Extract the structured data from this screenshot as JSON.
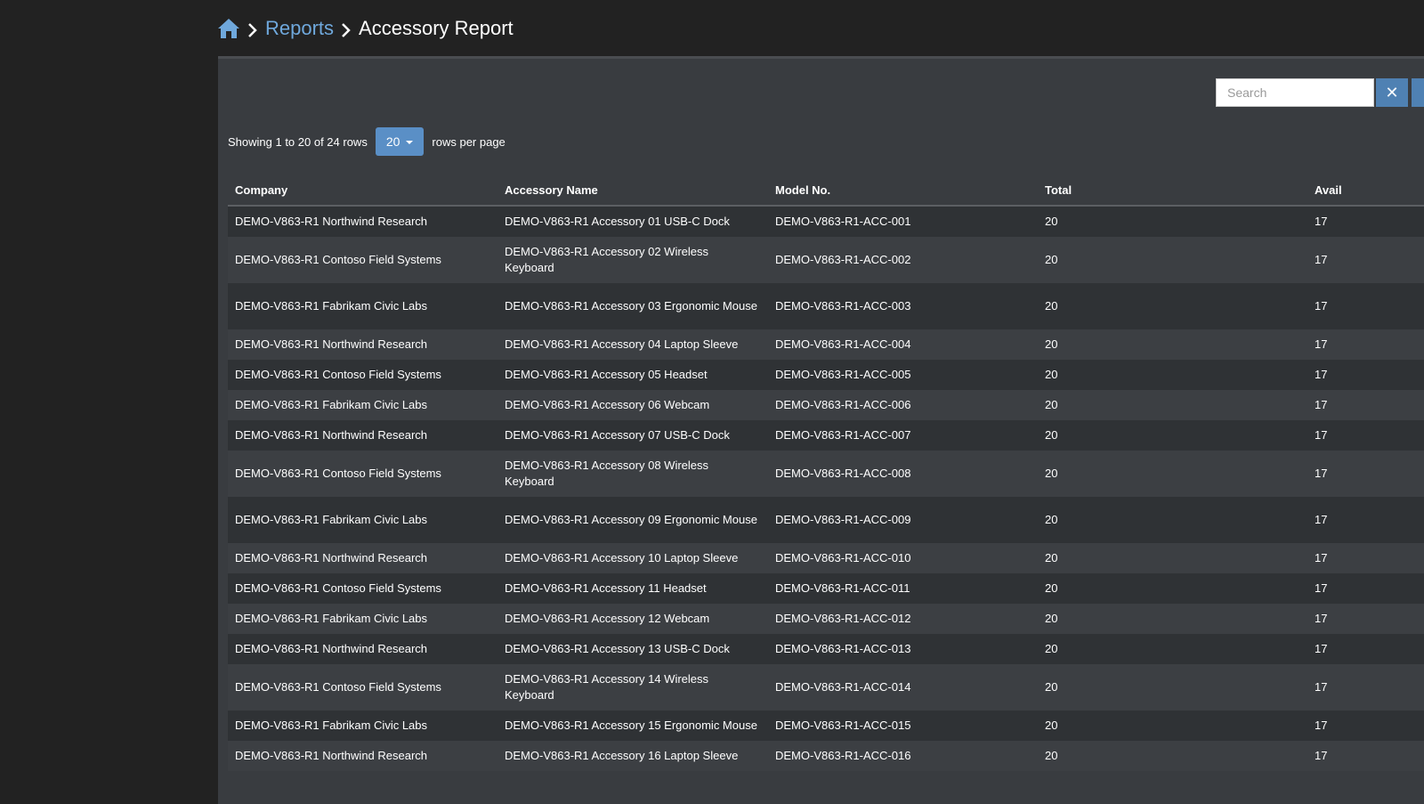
{
  "breadcrumb": {
    "home_icon": "home-icon",
    "parent": "Reports",
    "current": "Accessory Report"
  },
  "toolbar": {
    "search_placeholder": "Search",
    "clear_label": "✕"
  },
  "pagination": {
    "showing_text": "Showing 1 to 20 of 24 rows",
    "page_size": "20",
    "per_page_text": "rows per page"
  },
  "table": {
    "headers": [
      "Company",
      "Accessory Name",
      "Model No.",
      "Total",
      "Avail"
    ],
    "rows": [
      {
        "company": "DEMO-V863-R1 Northwind Research",
        "name": "DEMO-V863-R1 Accessory 01 USB-C Dock",
        "model": "DEMO-V863-R1-ACC-001",
        "total": "20",
        "avail": "17"
      },
      {
        "company": "DEMO-V863-R1 Contoso Field Systems",
        "name": "DEMO-V863-R1 Accessory 02 Wireless Keyboard",
        "model": "DEMO-V863-R1-ACC-002",
        "total": "20",
        "avail": "17"
      },
      {
        "company": "DEMO-V863-R1 Fabrikam Civic Labs",
        "name": "DEMO-V863-R1 Accessory 03 Ergonomic Mouse",
        "model": "DEMO-V863-R1-ACC-003",
        "total": "20",
        "avail": "17"
      },
      {
        "company": "DEMO-V863-R1 Northwind Research",
        "name": "DEMO-V863-R1 Accessory 04 Laptop Sleeve",
        "model": "DEMO-V863-R1-ACC-004",
        "total": "20",
        "avail": "17"
      },
      {
        "company": "DEMO-V863-R1 Contoso Field Systems",
        "name": "DEMO-V863-R1 Accessory 05 Headset",
        "model": "DEMO-V863-R1-ACC-005",
        "total": "20",
        "avail": "17"
      },
      {
        "company": "DEMO-V863-R1 Fabrikam Civic Labs",
        "name": "DEMO-V863-R1 Accessory 06 Webcam",
        "model": "DEMO-V863-R1-ACC-006",
        "total": "20",
        "avail": "17"
      },
      {
        "company": "DEMO-V863-R1 Northwind Research",
        "name": "DEMO-V863-R1 Accessory 07 USB-C Dock",
        "model": "DEMO-V863-R1-ACC-007",
        "total": "20",
        "avail": "17"
      },
      {
        "company": "DEMO-V863-R1 Contoso Field Systems",
        "name": "DEMO-V863-R1 Accessory 08 Wireless Keyboard",
        "model": "DEMO-V863-R1-ACC-008",
        "total": "20",
        "avail": "17"
      },
      {
        "company": "DEMO-V863-R1 Fabrikam Civic Labs",
        "name": "DEMO-V863-R1 Accessory 09 Ergonomic Mouse",
        "model": "DEMO-V863-R1-ACC-009",
        "total": "20",
        "avail": "17"
      },
      {
        "company": "DEMO-V863-R1 Northwind Research",
        "name": "DEMO-V863-R1 Accessory 10 Laptop Sleeve",
        "model": "DEMO-V863-R1-ACC-010",
        "total": "20",
        "avail": "17"
      },
      {
        "company": "DEMO-V863-R1 Contoso Field Systems",
        "name": "DEMO-V863-R1 Accessory 11 Headset",
        "model": "DEMO-V863-R1-ACC-011",
        "total": "20",
        "avail": "17"
      },
      {
        "company": "DEMO-V863-R1 Fabrikam Civic Labs",
        "name": "DEMO-V863-R1 Accessory 12 Webcam",
        "model": "DEMO-V863-R1-ACC-012",
        "total": "20",
        "avail": "17"
      },
      {
        "company": "DEMO-V863-R1 Northwind Research",
        "name": "DEMO-V863-R1 Accessory 13 USB-C Dock",
        "model": "DEMO-V863-R1-ACC-013",
        "total": "20",
        "avail": "17"
      },
      {
        "company": "DEMO-V863-R1 Contoso Field Systems",
        "name": "DEMO-V863-R1 Accessory 14 Wireless Keyboard",
        "model": "DEMO-V863-R1-ACC-014",
        "total": "20",
        "avail": "17"
      },
      {
        "company": "DEMO-V863-R1 Fabrikam Civic Labs",
        "name": "DEMO-V863-R1 Accessory 15 Ergonomic Mouse",
        "model": "DEMO-V863-R1-ACC-015",
        "total": "20",
        "avail": "17"
      },
      {
        "company": "DEMO-V863-R1 Northwind Research",
        "name": "DEMO-V863-R1 Accessory 16 Laptop Sleeve",
        "model": "DEMO-V863-R1-ACC-016",
        "total": "20",
        "avail": "17"
      }
    ]
  }
}
